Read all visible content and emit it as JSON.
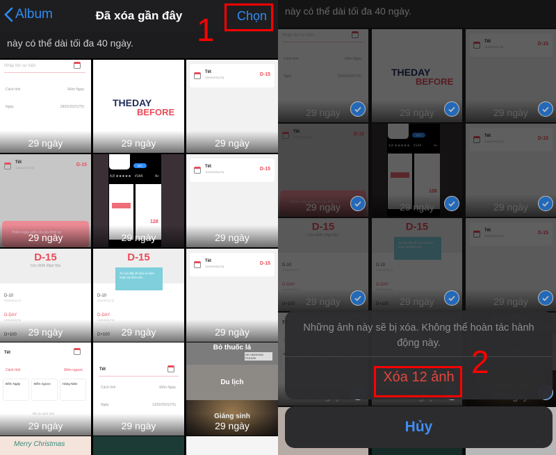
{
  "left": {
    "nav": {
      "back_label": "Album",
      "title": "Đã xóa gần đây",
      "select_label": "Chọn"
    },
    "subtitle": "này có thể dài tối đa 40 ngày.",
    "annotation_1": "1"
  },
  "right": {
    "subtitle": "này có thể dài tối đa 40 ngày.",
    "sheet": {
      "message": "Những ảnh này sẽ bị xóa. Không thể hoàn tác hành động này.",
      "delete_label": "Xóa 12 ảnh",
      "cancel_label": "Hủy"
    },
    "annotation_2": "2",
    "selected_count": 12
  },
  "colors": {
    "accent": "#2f8cf6",
    "destructive": "#e4463c",
    "annotation": "#ff0000",
    "app_red": "#e94b58"
  },
  "tiles": [
    {
      "type": "form",
      "label": "29 ngày",
      "placeholder": "Nhập tên sự kiện",
      "rows": [
        {
          "k": "Cách tính",
          "v": "Đếm Ngày"
        },
        {
          "k": "Ngày",
          "v": "28/01/2021(T5)"
        }
      ]
    },
    {
      "type": "logo",
      "label": "29 ngày",
      "l1": "THEDAY",
      "l2": "BEFORE"
    },
    {
      "type": "event",
      "label": "29 ngày",
      "title": "Tết",
      "date": "12/02/2021(T6)",
      "badge": "D-15"
    },
    {
      "type": "event",
      "grey": true,
      "label": "29 ngày",
      "title": "Tết",
      "date": "12/02/2021(T6)",
      "badge": "D-15",
      "banner": "Thêm ngày sinh của gia đình và"
    },
    {
      "type": "app",
      "label": "29 ngày",
      "open": "MỞ",
      "rating": "4,8 ★★★★★",
      "rank": "#144",
      "age": "4+",
      "num": "128"
    },
    {
      "type": "event",
      "label": "29 ngày",
      "title": "Tết",
      "date": "12/02/2021(T6)",
      "badge": "D-15"
    },
    {
      "type": "count",
      "label": "29 ngày",
      "big": "D-15",
      "sub": "Còn 343h 20ph 55s",
      "items": [
        {
          "k": "D-10",
          "d": "02/02/2021(T3)"
        },
        {
          "k": "D-DAY",
          "d": "12/02/2021(T6)"
        },
        {
          "k": "D+100",
          "d": ""
        }
      ]
    },
    {
      "type": "count",
      "label": "29 ngày",
      "big": "D-15",
      "tip": "Ấn vào đây để sửa sự kiện hoặc cài hình nền.",
      "items": [
        {
          "k": "D-10",
          "d": "02/02/2021(T3)"
        },
        {
          "k": "D-DAY",
          "d": "12/02/2021(T6)"
        },
        {
          "k": "D+100",
          "d": ""
        }
      ]
    },
    {
      "type": "event",
      "label": "29 ngày",
      "title": "Tết",
      "date": "12/02/2021(T6)",
      "badge": "D-15"
    },
    {
      "type": "options",
      "label": "29 ngày",
      "title": "Tết",
      "k": "Cách tính",
      "v": "Đếm ngược",
      "opts": [
        "Đếm Ngày",
        "Đếm ngược",
        "Hàng Năm"
      ],
      "footer": "Tất cả cách tính"
    },
    {
      "type": "form2",
      "label": "29 ngày",
      "title": "Tết",
      "rows": [
        {
          "k": "Cách tính",
          "v": "Đếm Ngày"
        },
        {
          "k": "Ngày",
          "v": "12/02/2021(T6)"
        }
      ]
    },
    {
      "type": "collage",
      "label": "29 ngày",
      "a": "Bỏ thuốc lá",
      "sign": "NO SMOKING PLEASE",
      "b": "Du lịch",
      "c": "Giáng sinh"
    },
    {
      "type": "partial",
      "bg": "#f4e4dc",
      "text": "Merry Christmas"
    },
    {
      "type": "partial",
      "bg": "#1d3b36",
      "text": ""
    },
    {
      "type": "partial",
      "bg": "#f5f5f5",
      "text": ""
    }
  ]
}
